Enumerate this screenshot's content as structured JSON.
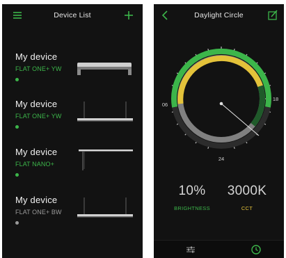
{
  "colors": {
    "green": "#3cb54a",
    "yellow": "#e3c23a",
    "gray": "#9a9a9a",
    "background": "#121212"
  },
  "device_list": {
    "title": "Device List",
    "menu_icon": "hamburger-menu-icon",
    "add_icon": "plus-icon",
    "devices": [
      {
        "name": "My device",
        "model": "FLAT ONE+ YW",
        "status_color": "#3cb54a",
        "lamp": "flat-one-lamp"
      },
      {
        "name": "My device",
        "model": "FLAT ONE+ YW",
        "status_color": "#3cb54a",
        "lamp": "hanging-flat-lamp"
      },
      {
        "name": "My device",
        "model": "FLAT NANO+",
        "status_color": "#3cb54a",
        "lamp": "flat-nano-lamp"
      },
      {
        "name": "My device",
        "model": "FLAT ONE+ BW",
        "status_color": "#9a9a9a",
        "lamp": "hanging-flat-lamp"
      }
    ]
  },
  "daylight": {
    "title": "Daylight Circle",
    "back_icon": "chevron-left-icon",
    "edit_icon": "edit-pencil-icon",
    "dial": {
      "hour_labels": [
        "12",
        "18",
        "24",
        "06"
      ]
    },
    "brightness": {
      "value": "10%",
      "label": "BRIGHTNESS"
    },
    "cct": {
      "value": "3000K",
      "label": "CCT"
    },
    "tabs": [
      {
        "icon": "sliders-icon"
      },
      {
        "icon": "clock-icon",
        "active": true
      }
    ]
  }
}
